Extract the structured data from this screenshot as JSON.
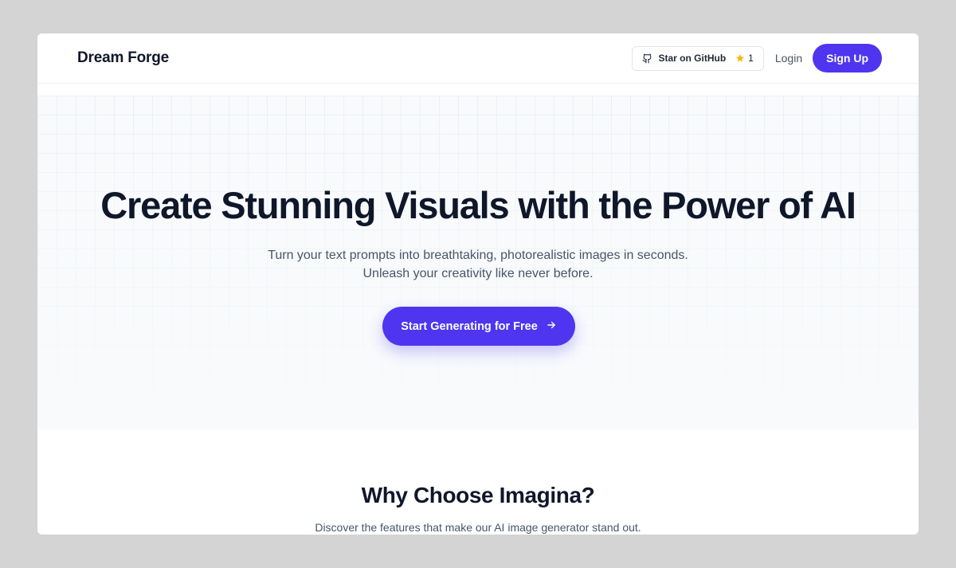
{
  "header": {
    "brand": "Dream Forge",
    "github_label": "Star on GitHub",
    "github_stars": "1",
    "login_label": "Login",
    "signup_label": "Sign Up"
  },
  "hero": {
    "title": "Create Stunning Visuals with the Power of AI",
    "subtitle_line1": "Turn your text prompts into breathtaking, photorealistic images in seconds.",
    "subtitle_line2": "Unleash your creativity like never before.",
    "cta_label": "Start Generating for Free"
  },
  "why": {
    "title": "Why Choose Imagina?",
    "subtitle": "Discover the features that make our AI image generator stand out."
  },
  "colors": {
    "accent": "#4f35f0",
    "heading": "#0f172a",
    "muted": "#475569",
    "star": "#f5b70a"
  },
  "icons": {
    "github": "github-icon",
    "star": "star-icon",
    "arrow": "arrow-right-icon"
  }
}
